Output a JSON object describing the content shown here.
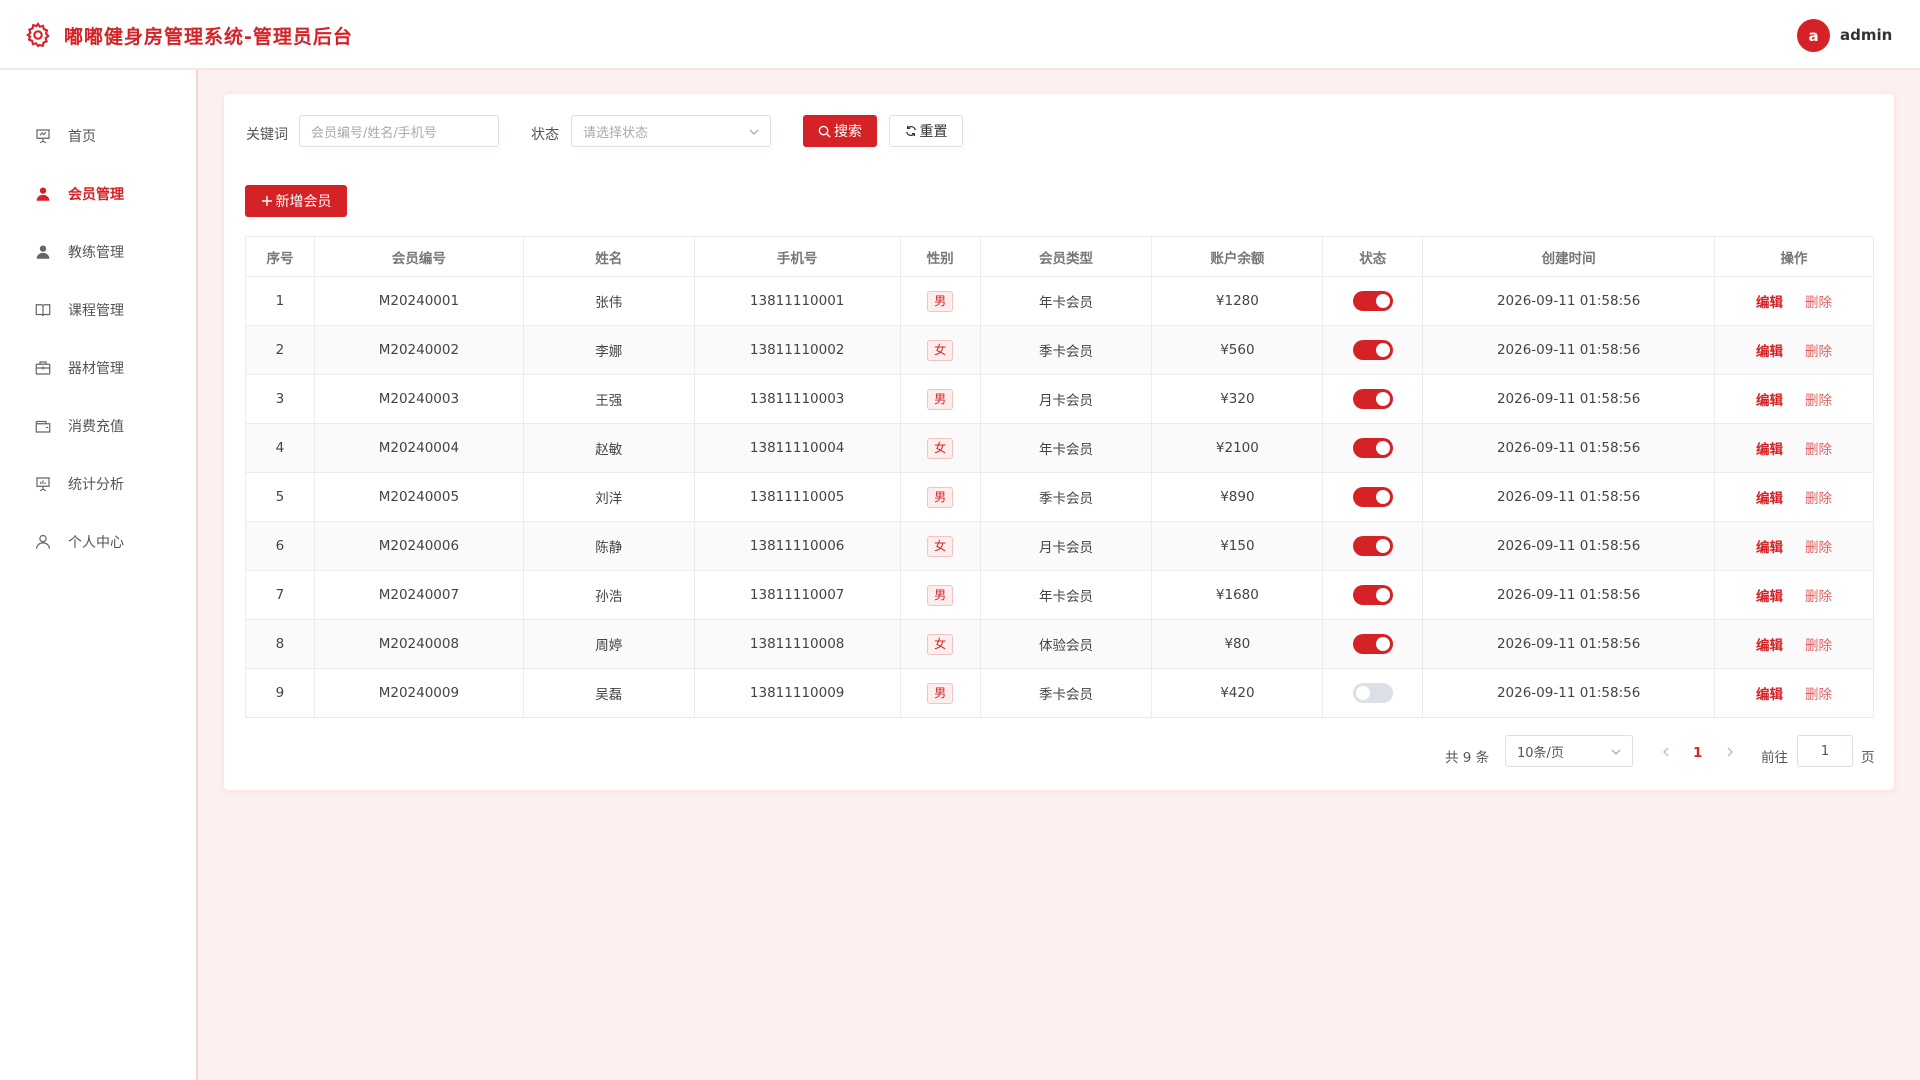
{
  "header": {
    "title": "嘟嘟健身房管理系统-管理员后台",
    "avatar_letter": "a",
    "username": "admin"
  },
  "sidebar": {
    "items": [
      {
        "label": "首页",
        "icon": "presentation-icon",
        "active": false
      },
      {
        "label": "会员管理",
        "icon": "user-solid-icon",
        "active": true
      },
      {
        "label": "教练管理",
        "icon": "user-solid-icon",
        "active": false
      },
      {
        "label": "课程管理",
        "icon": "book-icon",
        "active": false
      },
      {
        "label": "器材管理",
        "icon": "briefcase-icon",
        "active": false
      },
      {
        "label": "消费充值",
        "icon": "wallet-icon",
        "active": false
      },
      {
        "label": "统计分析",
        "icon": "chart-board-icon",
        "active": false
      },
      {
        "label": "个人中心",
        "icon": "user-outline-icon",
        "active": false
      }
    ]
  },
  "filters": {
    "keyword_label": "关键词",
    "keyword_placeholder": "会员编号/姓名/手机号",
    "status_label": "状态",
    "status_placeholder": "请选择状态",
    "search_label": "搜索",
    "reset_label": "重置"
  },
  "add_button_label": "新增会员",
  "table": {
    "columns": [
      "序号",
      "会员编号",
      "姓名",
      "手机号",
      "性别",
      "会员类型",
      "账户余额",
      "状态",
      "创建时间",
      "操作"
    ],
    "edit_label": "编辑",
    "delete_label": "删除",
    "rows": [
      {
        "no": "1",
        "id": "M20240001",
        "name": "张伟",
        "phone": "13811110001",
        "gender": "男",
        "type": "年卡会员",
        "balance": "¥1280",
        "enabled": true,
        "created": "2026-09-11 01:58:56"
      },
      {
        "no": "2",
        "id": "M20240002",
        "name": "李娜",
        "phone": "13811110002",
        "gender": "女",
        "type": "季卡会员",
        "balance": "¥560",
        "enabled": true,
        "created": "2026-09-11 01:58:56"
      },
      {
        "no": "3",
        "id": "M20240003",
        "name": "王强",
        "phone": "13811110003",
        "gender": "男",
        "type": "月卡会员",
        "balance": "¥320",
        "enabled": true,
        "created": "2026-09-11 01:58:56"
      },
      {
        "no": "4",
        "id": "M20240004",
        "name": "赵敏",
        "phone": "13811110004",
        "gender": "女",
        "type": "年卡会员",
        "balance": "¥2100",
        "enabled": true,
        "created": "2026-09-11 01:58:56"
      },
      {
        "no": "5",
        "id": "M20240005",
        "name": "刘洋",
        "phone": "13811110005",
        "gender": "男",
        "type": "季卡会员",
        "balance": "¥890",
        "enabled": true,
        "created": "2026-09-11 01:58:56"
      },
      {
        "no": "6",
        "id": "M20240006",
        "name": "陈静",
        "phone": "13811110006",
        "gender": "女",
        "type": "月卡会员",
        "balance": "¥150",
        "enabled": true,
        "created": "2026-09-11 01:58:56"
      },
      {
        "no": "7",
        "id": "M20240007",
        "name": "孙浩",
        "phone": "13811110007",
        "gender": "男",
        "type": "年卡会员",
        "balance": "¥1680",
        "enabled": true,
        "created": "2026-09-11 01:58:56"
      },
      {
        "no": "8",
        "id": "M20240008",
        "name": "周婷",
        "phone": "13811110008",
        "gender": "女",
        "type": "体验会员",
        "balance": "¥80",
        "enabled": true,
        "created": "2026-09-11 01:58:56"
      },
      {
        "no": "9",
        "id": "M20240009",
        "name": "吴磊",
        "phone": "13811110009",
        "gender": "男",
        "type": "季卡会员",
        "balance": "¥420",
        "enabled": false,
        "created": "2026-09-11 01:58:56"
      }
    ]
  },
  "pagination": {
    "total_text": "共 9 条",
    "page_size": "10条/页",
    "current_page": "1",
    "goto_label": "前往",
    "goto_value": "1",
    "page_suffix": "页"
  },
  "colors": {
    "accent": "#d42227",
    "background": "#fdf0f0"
  }
}
